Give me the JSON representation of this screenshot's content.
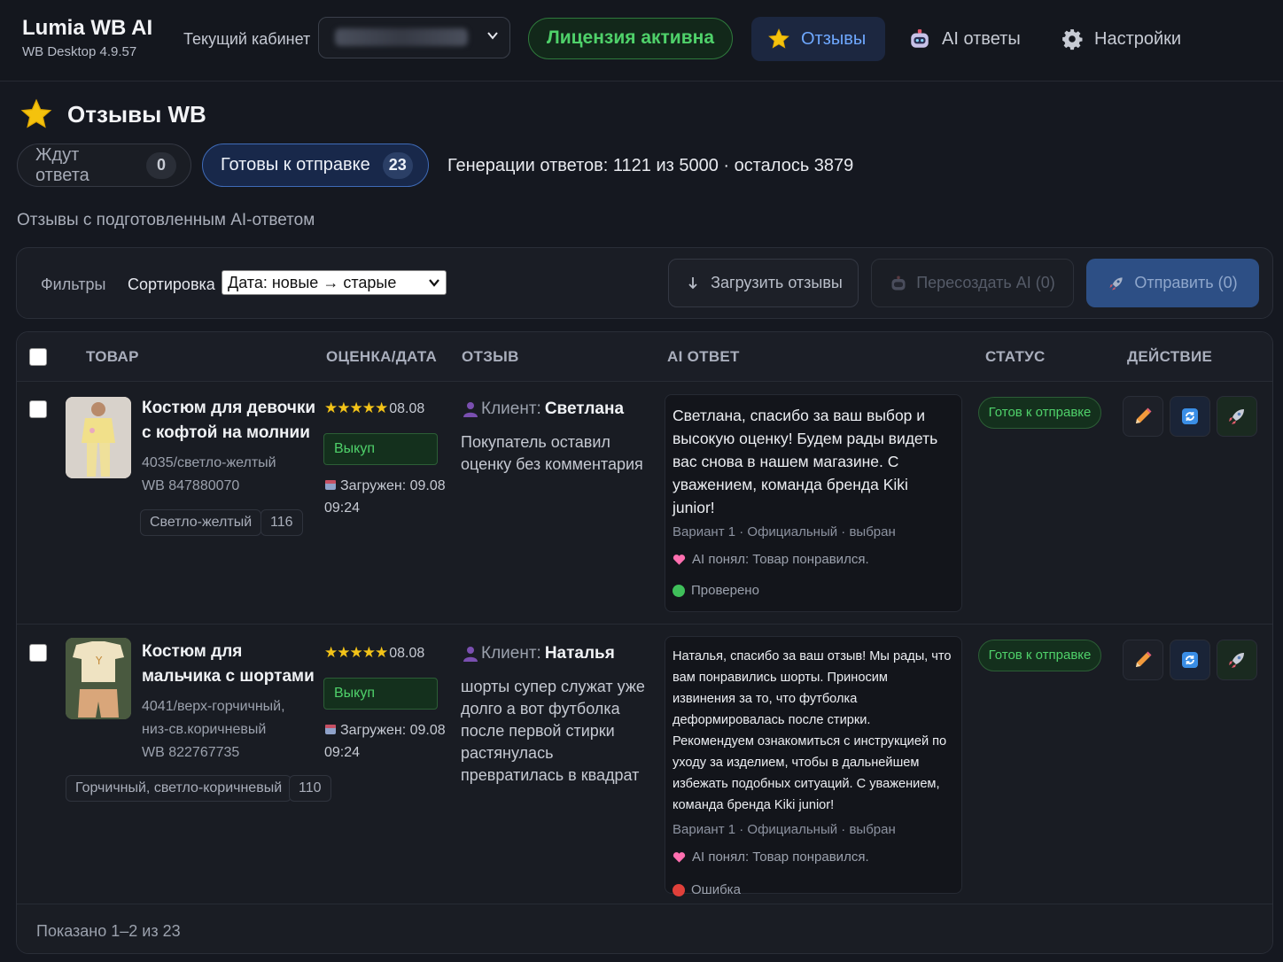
{
  "app": {
    "title": "Lumia WB AI",
    "version": "WB Desktop 4.9.57"
  },
  "header": {
    "cabinet_label": "Текущий кабинет",
    "cabinet_value": "",
    "license": "Лицензия активна",
    "nav": [
      {
        "label": "Отзывы",
        "icon": "star-icon",
        "active": true
      },
      {
        "label": "AI ответы",
        "icon": "robot-icon",
        "active": false
      },
      {
        "label": "Настройки",
        "icon": "gear-icon",
        "active": false
      }
    ]
  },
  "page": {
    "title": "Отзывы WB",
    "tabs": [
      {
        "label": "Ждут ответа",
        "count": "0"
      },
      {
        "label": "Готовы к отправке",
        "count": "23"
      }
    ],
    "generations": "Генерации ответов: 1121 из 5000 · осталось 3879",
    "subtitle": "Отзывы с подготовленным AI-ответом"
  },
  "toolbar": {
    "filters": "Фильтры",
    "sort_label": "Сортировка",
    "sort_value": "Дата: новые → старые",
    "load_button": "Загрузить отзывы",
    "regen_button": "Пересоздать AI (0)",
    "send_button": "Отправить (0)"
  },
  "table": {
    "columns": [
      "ТОВАР",
      "ОЦЕНКА/ДАТА",
      "ОТЗЫВ",
      "AI ОТВЕТ",
      "СТАТУС",
      "ДЕЙСТВИЕ"
    ],
    "rows": [
      {
        "product_name": "Костюм для девочки с кофтой на молнии",
        "product_variant": "4035/светло-желтый",
        "product_sku": "WB 847880070",
        "tag_color": "Светло-желтый",
        "tag_size": "116",
        "rating_stars": "★★★★★",
        "rating": 5,
        "date": "08.08",
        "badge": "Выкуп",
        "loaded_label": "Загружен: 09.08",
        "loaded_time": "09:24",
        "client_label": "Клиент:",
        "client_name": "Светлана",
        "review_text": "Покупатель оставил оценку без комментария",
        "ai_text": "Светлана, спасибо за ваш выбор и высокую оценку! Будем рады видеть вас снова в нашем магазине. С уважением, команда бренда Kiki junior!",
        "ai_variant": "Вариант 1 · Официальный · выбран",
        "ai_understood": "AI понял: Товар понравился.",
        "check_status": "Проверено",
        "check_color": "#3fbf5a",
        "status": "Готов к отправке"
      },
      {
        "product_name": "Костюм для мальчика с шортами",
        "product_variant": "4041/верх-горчичный, низ-св.коричневый",
        "product_sku": "WB 822767735",
        "tag_color": "Горчичный, светло-коричневый",
        "tag_size": "110",
        "rating_stars": "★★★★★",
        "rating": 5,
        "date": "08.08",
        "badge": "Выкуп",
        "loaded_label": "Загружен: 09.08",
        "loaded_time": "09:24",
        "client_label": "Клиент:",
        "client_name": "Наталья",
        "review_text": "шорты супер служат уже долго а вот футболка после первой стирки растянулась превратилась в квадрат",
        "ai_text": "Наталья, спасибо за ваш отзыв! Мы рады, что вам понравились шорты. Приносим извинения за то, что футболка деформировалась после стирки. Рекомендуем ознакомиться с инструкцией по уходу за изделием, чтобы в дальнейшем избежать подобных ситуаций. С уважением, команда бренда Kiki junior!",
        "ai_variant": "Вариант 1 · Официальный · выбран",
        "ai_understood": "AI понял: Товар понравился.",
        "check_status": "Ошибка",
        "check_color": "#e0403a",
        "status": "Готов к отправке"
      }
    ],
    "footer": "Показано 1–2 из 23"
  },
  "colors": {
    "accent": "#3f6bb8",
    "success": "#4fd16a",
    "background": "#151820"
  }
}
